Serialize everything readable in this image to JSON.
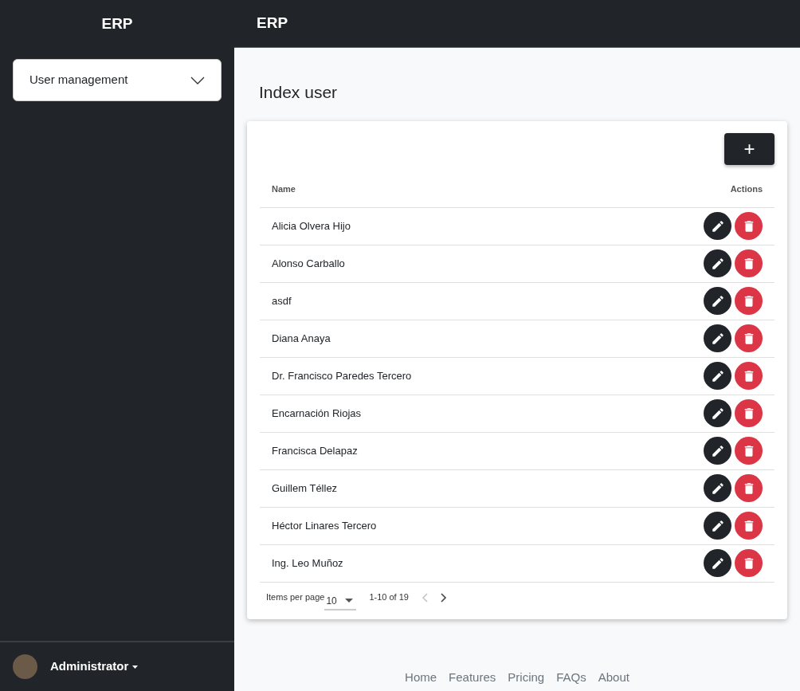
{
  "sidebar": {
    "brand": "ERP",
    "menu": {
      "label": "User management",
      "expanded": false
    },
    "user": {
      "name": "Administrator"
    }
  },
  "topbar": {
    "title": "ERP"
  },
  "page": {
    "title": "Index user",
    "add_button": "+"
  },
  "table": {
    "columns": [
      "Name",
      "Actions"
    ],
    "rows": [
      {
        "name": "Alicia Olvera Hijo"
      },
      {
        "name": "Alonso Carballo"
      },
      {
        "name": "asdf"
      },
      {
        "name": "Diana Anaya"
      },
      {
        "name": "Dr. Francisco Paredes Tercero"
      },
      {
        "name": "Encarnación Riojas"
      },
      {
        "name": "Francisca Delapaz"
      },
      {
        "name": "Guillem Téllez"
      },
      {
        "name": "Héctor Linares Tercero"
      },
      {
        "name": "Ing. Leo Muñoz"
      }
    ]
  },
  "paginator": {
    "label": "Items per page",
    "page_size": "10",
    "range": "1-10 of 19",
    "prev_disabled": true,
    "next_disabled": false
  },
  "footer": {
    "links": [
      "Home",
      "Features",
      "Pricing",
      "FAQs",
      "About"
    ]
  }
}
